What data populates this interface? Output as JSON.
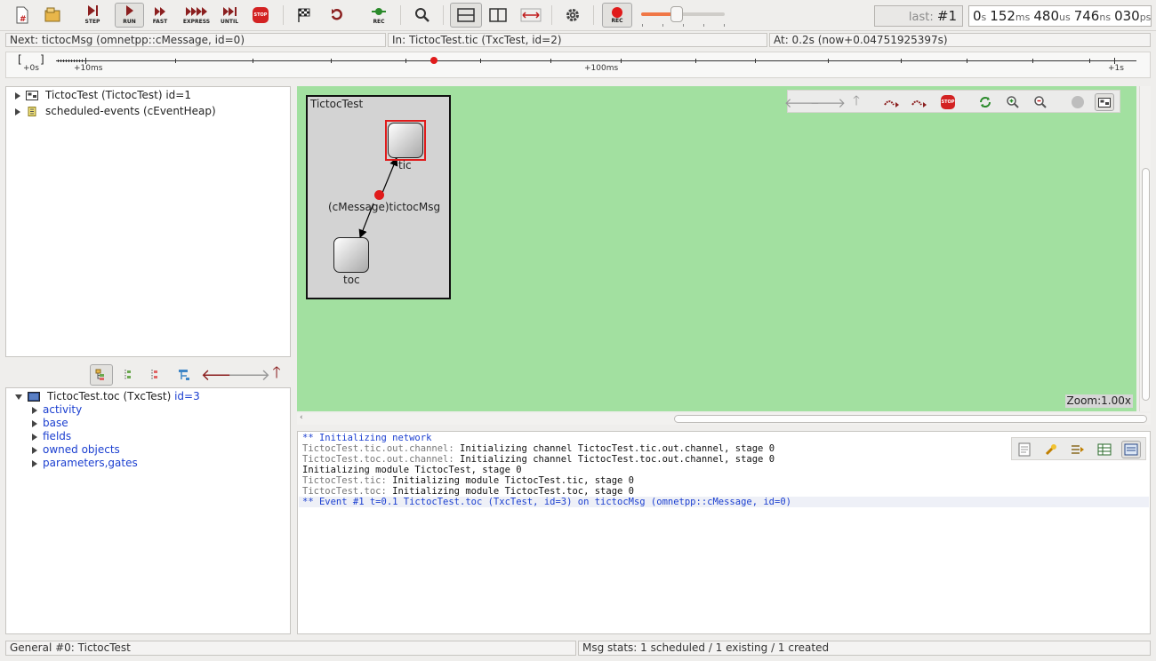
{
  "toolbar": {
    "step_label": "STEP",
    "run_label": "RUN",
    "fast_label": "FAST",
    "express_label": "EXPRESS",
    "until_label": "UNTIL",
    "stop_label": "STOP",
    "rec_label": "REC",
    "event_prefix": "last:",
    "event_number": "#1",
    "time": {
      "s": "0",
      "s_unit": "s",
      "ms": "152",
      "ms_unit": "ms",
      "us": "480",
      "us_unit": "us",
      "ns": "746",
      "ns_unit": "ns",
      "ps": "030",
      "ps_unit": "ps"
    },
    "speed_fraction": 0.42
  },
  "infobar": {
    "next": "Next: tictocMsg (omnetpp::cMessage, id=0)",
    "in": "In: TictocTest.tic (TxcTest, id=2)",
    "at": "At: 0.2s (now+0.04751925397s)"
  },
  "timeline": {
    "labels": [
      "+0s",
      "+10ms",
      "+100ms",
      "+1s"
    ],
    "bracket_open": "[",
    "bracket_close": "]"
  },
  "object_tree": [
    {
      "label": "TictocTest (TictocTest) id=1",
      "icon": "module-icon"
    },
    {
      "label": "scheduled-events (cEventHeap)",
      "icon": "event-heap-icon"
    }
  ],
  "inspector": {
    "title_main": "TictocTest.toc (TxcTest)",
    "title_id": "id=3",
    "children": [
      "activity",
      "base",
      "fields",
      "owned objects",
      "parameters,gates"
    ]
  },
  "canvas": {
    "network_name": "TictocTest",
    "nodes": [
      {
        "name": "tic",
        "highlighted": true
      },
      {
        "name": "toc",
        "highlighted": false
      }
    ],
    "message_label": "(cMessage)tictocMsg",
    "zoom": "Zoom:1.00x",
    "background_color": "#a2e0a0",
    "message_color": "#e01b1b"
  },
  "log": {
    "lines": [
      {
        "prefix": "",
        "text": "** Initializing network",
        "style": "blue"
      },
      {
        "prefix": "TictocTest.tic.out.channel:",
        "text": " Initializing channel TictocTest.tic.out.channel, stage 0",
        "style": "mixed"
      },
      {
        "prefix": "TictocTest.toc.out.channel:",
        "text": " Initializing channel TictocTest.toc.out.channel, stage 0",
        "style": "mixed"
      },
      {
        "prefix": "",
        "text": "Initializing module TictocTest, stage 0",
        "style": "dark"
      },
      {
        "prefix": "TictocTest.tic:",
        "text": " Initializing module TictocTest.tic, stage 0",
        "style": "mixed"
      },
      {
        "prefix": "TictocTest.toc:",
        "text": " Initializing module TictocTest.toc, stage 0",
        "style": "mixed"
      },
      {
        "prefix": "",
        "text": "** Event #1  t=0.1  TictocTest.toc (TxcTest, id=3)  on tictocMsg (omnetpp::cMessage, id=0)",
        "style": "blue"
      }
    ]
  },
  "statusbar": {
    "left": "General #0: TictocTest",
    "right": "Msg stats: 1 scheduled / 1 existing / 1 created"
  }
}
